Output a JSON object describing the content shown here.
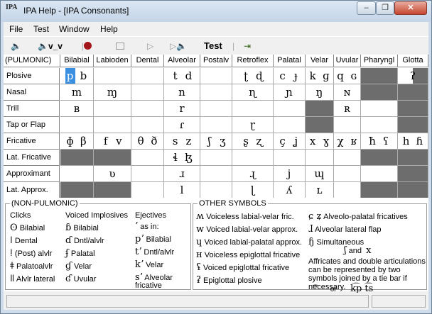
{
  "window": {
    "title": "IPA Help - [IPA Consonants]",
    "icon_text": "IPA"
  },
  "menu": [
    "File",
    "Test",
    "Window",
    "Help"
  ],
  "toolbar": {
    "vv_label": "v_v",
    "test_label": "Test"
  },
  "grid": {
    "corner": "(PULMONIC)",
    "columns": [
      "Bilabial",
      "Labioden",
      "Dental",
      "Alveolar",
      "Postalv",
      "Retroflex",
      "Palatal",
      "Velar",
      "Uvular",
      "Pharyngl",
      "Glotta"
    ],
    "rows": [
      {
        "label": "Plosive",
        "cells": [
          [
            "p",
            "b"
          ],
          [],
          [],
          [
            "t",
            "d"
          ],
          [],
          [
            "ʈ",
            "ɖ"
          ],
          [
            "c",
            "ɟ"
          ],
          [
            "k",
            "ɡ"
          ],
          [
            "q",
            "ɢ"
          ],
          [
            "gray"
          ],
          [
            "ʔ",
            "gray"
          ]
        ]
      },
      {
        "label": "Nasal",
        "cells": [
          [
            "m"
          ],
          [
            "ɱ"
          ],
          [],
          [
            "n"
          ],
          [],
          [
            "ɳ"
          ],
          [
            "ɲ"
          ],
          [
            "ŋ"
          ],
          [
            "ɴ"
          ],
          [
            "gray"
          ],
          [
            "gray"
          ]
        ]
      },
      {
        "label": "Trill",
        "cells": [
          [
            "ʙ"
          ],
          [],
          [],
          [
            "r"
          ],
          [],
          [],
          [],
          [
            "gray"
          ],
          [
            "ʀ"
          ],
          [],
          [
            "gray"
          ]
        ]
      },
      {
        "label": "Tap or Flap",
        "cells": [
          [],
          [],
          [],
          [
            "ɾ"
          ],
          [],
          [
            "ɽ"
          ],
          [],
          [
            "gray"
          ],
          [],
          [],
          [
            "gray"
          ]
        ]
      },
      {
        "label": "Fricative",
        "cells": [
          [
            "ɸ",
            "β"
          ],
          [
            "f",
            "v"
          ],
          [
            "θ",
            "ð"
          ],
          [
            "s",
            "z"
          ],
          [
            "ʃ",
            "ʒ"
          ],
          [
            "ʂ",
            "ʐ"
          ],
          [
            "ç",
            "ʝ"
          ],
          [
            "x",
            "ɣ"
          ],
          [
            "χ",
            "ʁ"
          ],
          [
            "ħ",
            "ʕ"
          ],
          [
            "h",
            "ɦ"
          ]
        ]
      },
      {
        "label": "Lat. Fricative",
        "cells": [
          [
            "gray"
          ],
          [
            "gray"
          ],
          [],
          [
            "ɬ",
            "ɮ"
          ],
          [],
          [],
          [],
          [],
          [],
          [
            "gray"
          ],
          [
            "gray"
          ]
        ]
      },
      {
        "label": "Approximant",
        "cells": [
          [],
          [
            "ʋ"
          ],
          [],
          [
            "ɹ"
          ],
          [],
          [
            "ɻ"
          ],
          [
            "j"
          ],
          [
            "ɰ"
          ],
          [],
          [],
          [
            "gray"
          ]
        ]
      },
      {
        "label": "Lat. Approx.",
        "cells": [
          [
            "gray"
          ],
          [
            "gray"
          ],
          [],
          [
            "l"
          ],
          [],
          [
            "ɭ"
          ],
          [
            "ʎ"
          ],
          [
            "ʟ"
          ],
          [],
          [
            "gray"
          ],
          [
            "gray"
          ]
        ]
      }
    ]
  },
  "nonpulmonic": {
    "legend": "(NON-PULMONIC)",
    "clicks_head": "Clicks",
    "clicks": [
      {
        "g": "ʘ",
        "t": "Bilabial"
      },
      {
        "g": "ǀ",
        "t": "Dental"
      },
      {
        "g": "ǃ",
        "t": "(Post) alvlr"
      },
      {
        "g": "ǂ",
        "t": "Palatoalvlr"
      },
      {
        "g": "ǁ",
        "t": "Alvlr lateral"
      }
    ],
    "implosives_head": "Voiced Implosives",
    "implosives": [
      {
        "g": "ɓ",
        "t": "Bilabial"
      },
      {
        "g": "ɗ",
        "t": "Dntl/alvlr"
      },
      {
        "g": "ʄ",
        "t": "Palatal"
      },
      {
        "g": "ɠ",
        "t": "Velar"
      },
      {
        "g": "ʛ",
        "t": "Uvular"
      }
    ],
    "ejectives_head": "Ejectives",
    "ejectives": [
      {
        "g": "ʼ",
        "t": "as in:"
      },
      {
        "g": "pʼ",
        "t": "Bilabial"
      },
      {
        "g": "tʼ",
        "t": "Dntl/alvlr"
      },
      {
        "g": "kʼ",
        "t": "Velar"
      },
      {
        "g": "sʼ",
        "t": "Alveolar fricative"
      }
    ]
  },
  "other": {
    "legend": "OTHER SYMBOLS",
    "left": [
      {
        "g": "ʍ",
        "t": "Voiceless labial-velar fric."
      },
      {
        "g": "w",
        "t": "Voiced labial-velar approx."
      },
      {
        "g": "ɥ",
        "t": "Voiced labial-palatal approx."
      },
      {
        "g": "ʜ",
        "t": "Voiceless epiglottal fricative"
      },
      {
        "g": "ʢ",
        "t": "Voiced epiglottal fricative"
      },
      {
        "g": "ʡ",
        "t": "Epiglottal plosive"
      }
    ],
    "right": [
      {
        "g": "ɕ ʑ",
        "t": "Alveolo-palatal fricatives"
      },
      {
        "g": "ɺ",
        "t": "Alveolar lateral flap"
      },
      {
        "g": "ɧ",
        "t": "Simultaneous"
      }
    ],
    "simul_and": "and",
    "simul_g1": "ʃ",
    "simul_g2": "x",
    "note": "Affricates and double articulations can be represented by two symbols joined by a tie bar if necessary.",
    "tie_or": "or",
    "tie_example": "k͡p t͡s"
  }
}
